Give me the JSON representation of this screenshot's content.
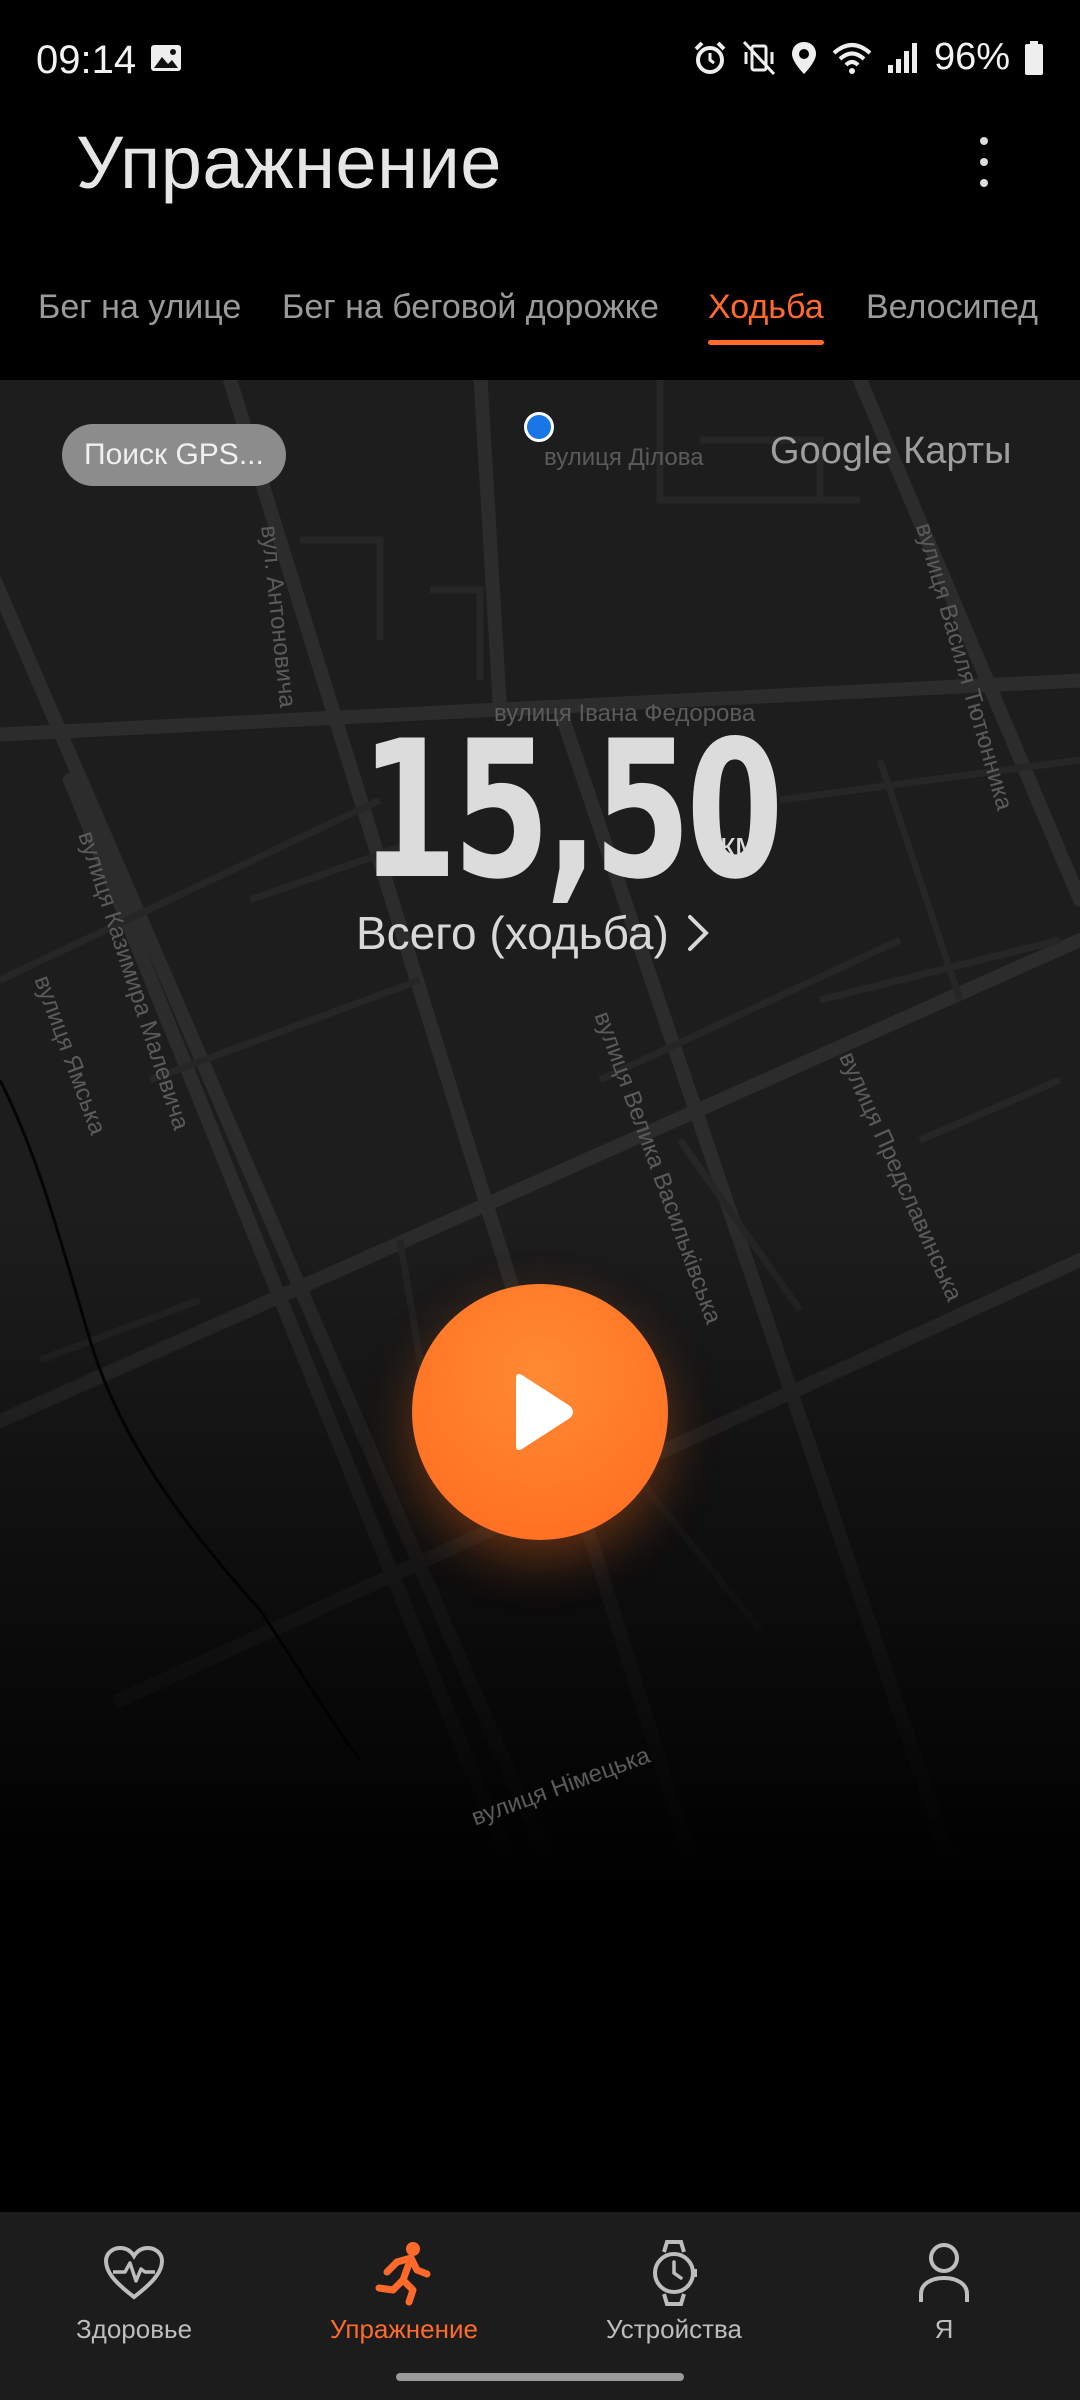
{
  "status_bar": {
    "time": "09:14",
    "battery": "96%",
    "icons": [
      "image-icon",
      "alarm-icon",
      "vibrate-mute-icon",
      "location-icon",
      "wifi-icon",
      "signal-icon",
      "battery-icon"
    ]
  },
  "header": {
    "title": "Упражнение",
    "menu_icon": "more-vert-icon"
  },
  "tabs": [
    {
      "label": "Бег на улице",
      "active": false
    },
    {
      "label": "Бег на беговой дорожке",
      "active": false
    },
    {
      "label": "Ходьба",
      "active": true
    },
    {
      "label": "Велосипед",
      "active": false
    }
  ],
  "map": {
    "gps_status": "Поиск GPS...",
    "provider": "Google Карты",
    "streets": [
      "вулиця Ділова",
      "вул. Антоновича",
      "вулиця Івана Федорова",
      "вулиця Василя Тютюнника",
      "вулиця Казимира Малевича",
      "вулиця Ямська",
      "вулиця Велика Васильківська",
      "вулиця Предславинська",
      "вулиця Німецька"
    ]
  },
  "summary": {
    "distance": "15,50",
    "unit": "км",
    "label": "Всего (ходьба)"
  },
  "start_button": {
    "icon": "play-icon"
  },
  "bottom_nav": [
    {
      "label": "Здоровье",
      "icon": "heart-pulse-icon",
      "active": false
    },
    {
      "label": "Упражнение",
      "icon": "running-icon",
      "active": true
    },
    {
      "label": "Устройства",
      "icon": "watch-icon",
      "active": false
    },
    {
      "label": "Я",
      "icon": "person-icon",
      "active": false
    }
  ],
  "colors": {
    "accent": "#ff6a2b",
    "background": "#000000",
    "map_bg": "#1d1d1d"
  }
}
